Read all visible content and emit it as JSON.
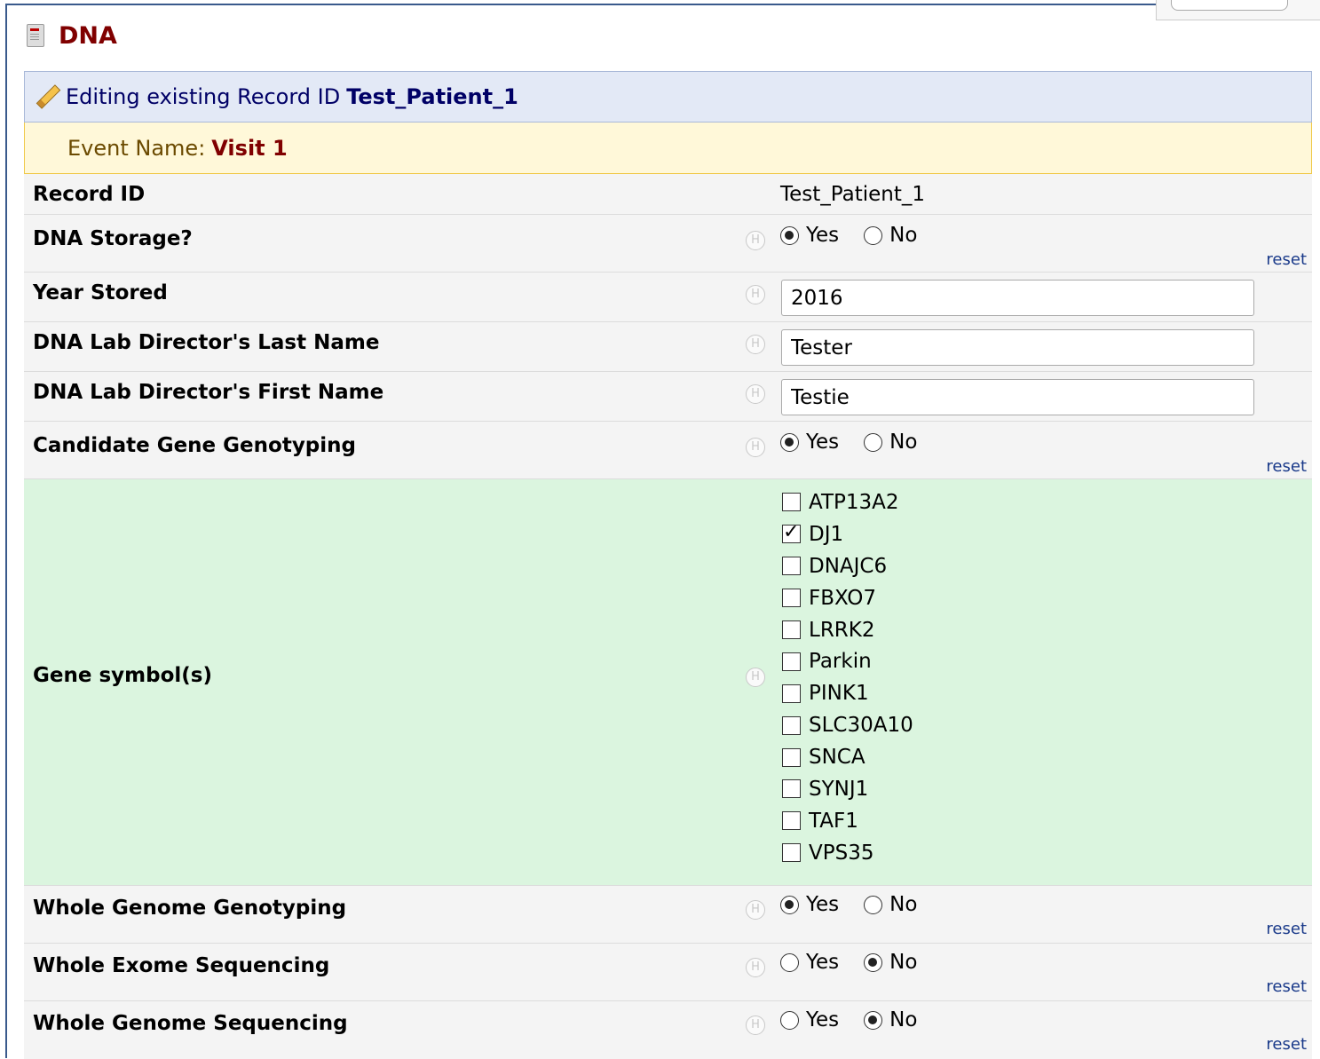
{
  "form": {
    "title": "DNA"
  },
  "banner": {
    "edit_prefix": "Editing existing Record ID",
    "record_id": "Test_Patient_1",
    "event_label": "Event Name:",
    "event_name": "Visit 1"
  },
  "help_glyph": "H",
  "reset_label": "reset",
  "fields": {
    "record_id": {
      "label": "Record ID",
      "value": "Test_Patient_1"
    },
    "dna_storage": {
      "label": "DNA Storage?",
      "options": [
        "Yes",
        "No"
      ],
      "selected": "Yes"
    },
    "year_stored": {
      "label": "Year Stored",
      "value": "2016"
    },
    "director_last": {
      "label": "DNA Lab Director's Last Name",
      "value": "Tester"
    },
    "director_first": {
      "label": "DNA Lab Director's First Name",
      "value": "Testie"
    },
    "candidate_gene": {
      "label": "Candidate Gene Genotyping",
      "options": [
        "Yes",
        "No"
      ],
      "selected": "Yes"
    },
    "gene_symbols": {
      "label": "Gene symbol(s)",
      "options": [
        "ATP13A2",
        "DJ1",
        "DNAJC6",
        "FBXO7",
        "LRRK2",
        "Parkin",
        "PINK1",
        "SLC30A10",
        "SNCA",
        "SYNJ1",
        "TAF1",
        "VPS35"
      ],
      "checked": [
        "DJ1"
      ]
    },
    "whole_genome_genotyping": {
      "label": "Whole Genome Genotyping",
      "options": [
        "Yes",
        "No"
      ],
      "selected": "Yes"
    },
    "whole_exome_sequencing": {
      "label": "Whole Exome Sequencing",
      "options": [
        "Yes",
        "No"
      ],
      "selected": "No"
    },
    "whole_genome_sequencing": {
      "label": "Whole Genome Sequencing",
      "options": [
        "Yes",
        "No"
      ],
      "selected": "No"
    }
  },
  "colors": {
    "title": "#800000",
    "edit_banner_bg": "#e3e9f6",
    "event_banner_bg": "#fff8d9",
    "row_bg": "#f4f4f4",
    "highlight_row_bg": "#dbf5df",
    "link": "#1a3a8a"
  }
}
